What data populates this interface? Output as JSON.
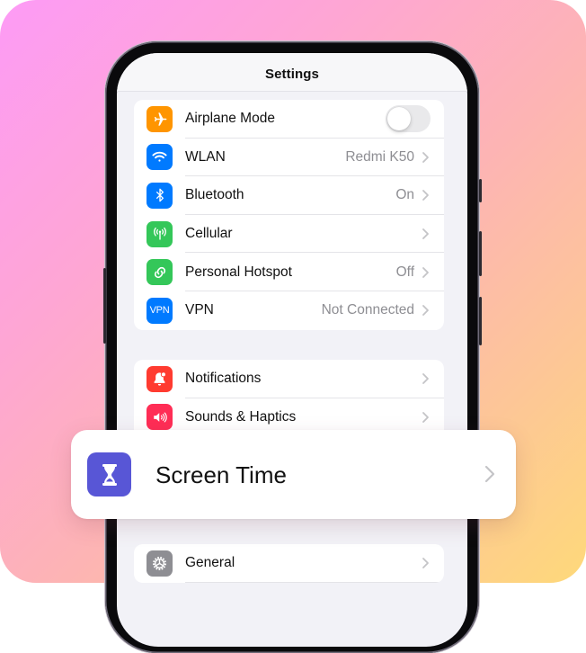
{
  "screen": {
    "title": "Settings"
  },
  "groups": [
    {
      "rows": [
        {
          "label": "Airplane Mode",
          "icon": "airplane-icon",
          "icon_color": "#ff9500",
          "control": "toggle",
          "toggle_on": false
        },
        {
          "label": "WLAN",
          "icon": "wifi-icon",
          "icon_color": "#007aff",
          "value": "Redmi K50"
        },
        {
          "label": "Bluetooth",
          "icon": "bluetooth-icon",
          "icon_color": "#007aff",
          "value": "On"
        },
        {
          "label": "Cellular",
          "icon": "cellular-antenna-icon",
          "icon_color": "#34c759",
          "value": ""
        },
        {
          "label": "Personal Hotspot",
          "icon": "hotspot-link-icon",
          "icon_color": "#34c759",
          "value": "Off"
        },
        {
          "label": "VPN",
          "icon": "vpn-icon",
          "icon_text": "VPN",
          "icon_color": "#007aff",
          "value": "Not Connected"
        }
      ]
    },
    {
      "rows": [
        {
          "label": "Notifications",
          "icon": "notification-bell-icon",
          "icon_color": "#ff3b30"
        },
        {
          "label": "Sounds & Haptics",
          "icon": "speaker-icon",
          "icon_color": "#ff2d55"
        }
      ]
    },
    {
      "rows": [
        {
          "label": "General",
          "icon": "gear-icon",
          "icon_color": "#8e8e93"
        }
      ]
    }
  ],
  "highlight_card": {
    "label": "Screen Time",
    "icon": "hourglass-icon",
    "icon_color": "#5856d6"
  }
}
